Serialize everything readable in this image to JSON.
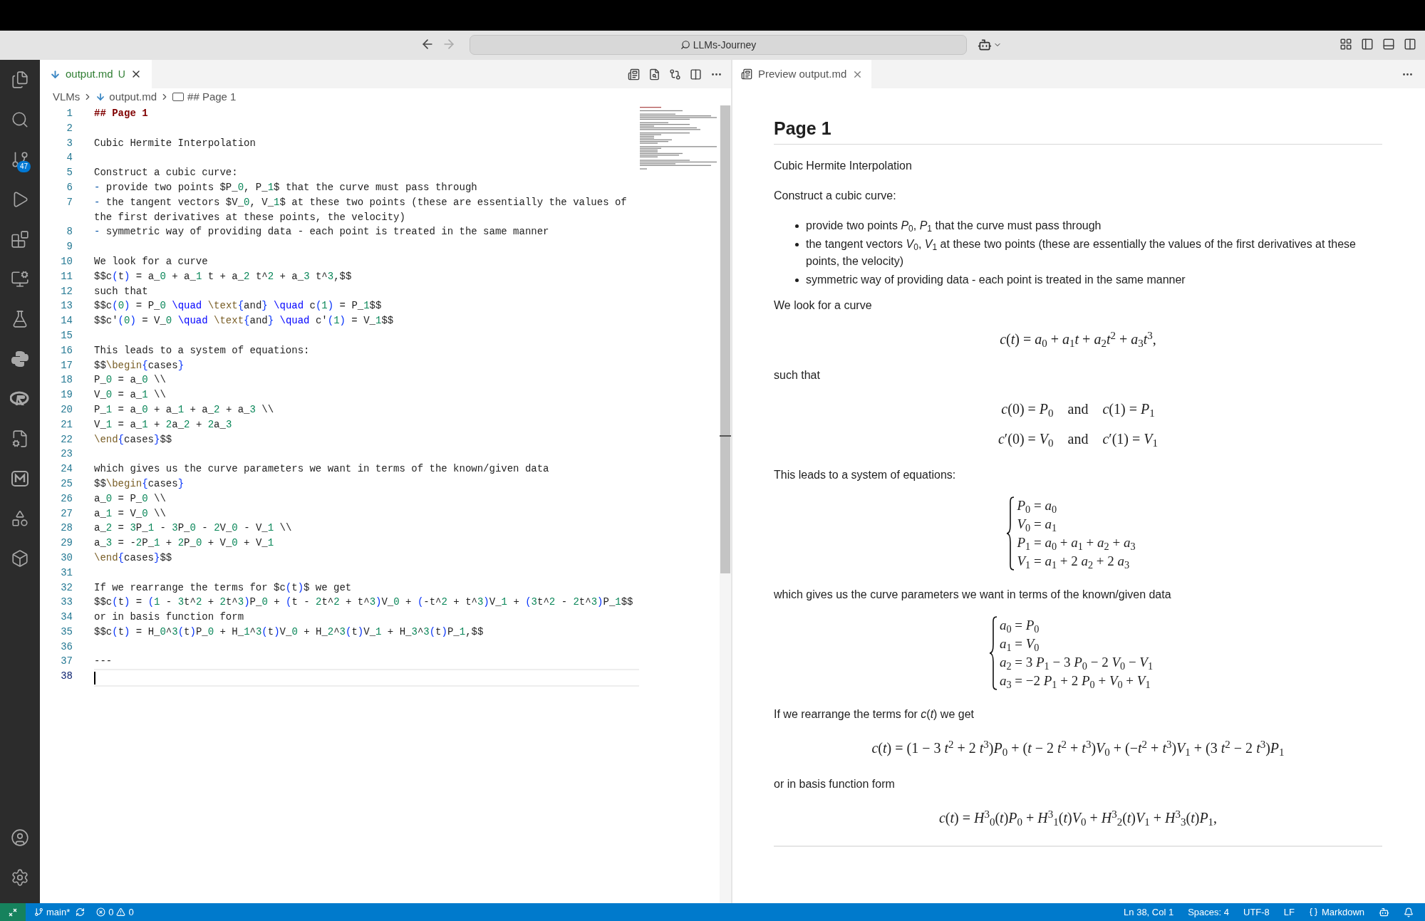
{
  "title_bar": {
    "search": "LLMs-Journey"
  },
  "activity_bar": {
    "source_control_badge": "47"
  },
  "editor": {
    "tab": {
      "label": "output.md",
      "status": "U",
      "selected": true
    },
    "breadcrumb": [
      {
        "text": "VLMs",
        "kind": "folder"
      },
      {
        "text": "output.md",
        "kind": "file"
      },
      {
        "text": "## Page 1",
        "kind": "symbol"
      }
    ],
    "lines": [
      {
        "number": "1",
        "active": false,
        "tokens": [
          {
            "text": "## Page 1",
            "kind": "heading"
          }
        ]
      },
      {
        "number": "2",
        "active": false
      },
      {
        "number": "3",
        "active": false,
        "tokens": [
          {
            "text": "Cubic Hermite Interpolation",
            "kind": "text"
          }
        ]
      },
      {
        "number": "4",
        "active": false
      },
      {
        "number": "5",
        "active": false,
        "tokens": [
          {
            "text": "Construct a cubic curve:",
            "kind": "text"
          }
        ]
      },
      {
        "number": "6",
        "active": false,
        "tokens": [
          {
            "text": "- ",
            "kind": "marker"
          },
          {
            "text": "provide two points $P_",
            "kind": "text"
          },
          {
            "text": "0",
            "kind": "num"
          },
          {
            "text": ", P_",
            "kind": "text"
          },
          {
            "text": "1",
            "kind": "num"
          },
          {
            "text": "$ that the curve must pass through",
            "kind": "text"
          }
        ]
      },
      {
        "number": "7",
        "active": false,
        "tokens": [
          {
            "text": "- ",
            "kind": "marker"
          },
          {
            "text": "the tangent vectors $V_",
            "kind": "text"
          },
          {
            "text": "0",
            "kind": "num"
          },
          {
            "text": ", V_",
            "kind": "text"
          },
          {
            "text": "1",
            "kind": "num"
          },
          {
            "text": "$ at these two points (these are essentially the values of the first derivatives at these points, the velocity)",
            "kind": "text"
          }
        ]
      },
      {
        "number": "8",
        "active": false,
        "tokens": [
          {
            "text": "- ",
            "kind": "marker"
          },
          {
            "text": "symmetric way of providing data - each point is treated in the same manner",
            "kind": "text"
          }
        ]
      },
      {
        "number": "9",
        "active": false
      },
      {
        "number": "10",
        "active": false,
        "tokens": [
          {
            "text": "We look for a curve",
            "kind": "text"
          }
        ]
      },
      {
        "number": "11",
        "active": false,
        "tokens": [
          {
            "text": "$$c",
            "kind": "text"
          },
          {
            "text": "(",
            "kind": "paren"
          },
          {
            "text": "t",
            "kind": "text"
          },
          {
            "text": ")",
            "kind": "paren"
          },
          {
            "text": " = a_",
            "kind": "text"
          },
          {
            "text": "0",
            "kind": "num"
          },
          {
            "text": " + a_",
            "kind": "text"
          },
          {
            "text": "1",
            "kind": "num"
          },
          {
            "text": " t + a_",
            "kind": "text"
          },
          {
            "text": "2",
            "kind": "num"
          },
          {
            "text": " t^",
            "kind": "text"
          },
          {
            "text": "2",
            "kind": "num"
          },
          {
            "text": " + a_",
            "kind": "text"
          },
          {
            "text": "3",
            "kind": "num"
          },
          {
            "text": " t^",
            "kind": "text"
          },
          {
            "text": "3",
            "kind": "num"
          },
          {
            "text": ",$$",
            "kind": "text"
          }
        ]
      },
      {
        "number": "12",
        "active": false,
        "tokens": [
          {
            "text": "such that",
            "kind": "text"
          }
        ]
      },
      {
        "number": "13",
        "active": false,
        "tokens": [
          {
            "text": "$$c",
            "kind": "text"
          },
          {
            "text": "(",
            "kind": "paren"
          },
          {
            "text": "0",
            "kind": "num"
          },
          {
            "text": ")",
            "kind": "paren"
          },
          {
            "text": " = P_",
            "kind": "text"
          },
          {
            "text": "0",
            "kind": "num"
          },
          {
            "text": " \\quad ",
            "kind": "cmd"
          },
          {
            "text": "\\text",
            "kind": "func"
          },
          {
            "text": "{",
            "kind": "paren"
          },
          {
            "text": "and",
            "kind": "text"
          },
          {
            "text": "}",
            "kind": "paren"
          },
          {
            "text": " \\quad",
            "kind": "cmd"
          },
          {
            "text": " c",
            "kind": "text"
          },
          {
            "text": "(",
            "kind": "paren"
          },
          {
            "text": "1",
            "kind": "num"
          },
          {
            "text": ")",
            "kind": "paren"
          },
          {
            "text": " = P_",
            "kind": "text"
          },
          {
            "text": "1",
            "kind": "num"
          },
          {
            "text": "$$",
            "kind": "text"
          }
        ]
      },
      {
        "number": "14",
        "active": false,
        "tokens": [
          {
            "text": "$$c'",
            "kind": "text"
          },
          {
            "text": "(",
            "kind": "paren"
          },
          {
            "text": "0",
            "kind": "num"
          },
          {
            "text": ")",
            "kind": "paren"
          },
          {
            "text": " = V_",
            "kind": "text"
          },
          {
            "text": "0",
            "kind": "num"
          },
          {
            "text": " \\quad ",
            "kind": "cmd"
          },
          {
            "text": "\\text",
            "kind": "func"
          },
          {
            "text": "{",
            "kind": "paren"
          },
          {
            "text": "and",
            "kind": "text"
          },
          {
            "text": "}",
            "kind": "paren"
          },
          {
            "text": " \\quad",
            "kind": "cmd"
          },
          {
            "text": " c'",
            "kind": "text"
          },
          {
            "text": "(",
            "kind": "paren"
          },
          {
            "text": "1",
            "kind": "num"
          },
          {
            "text": ")",
            "kind": "paren"
          },
          {
            "text": " = V_",
            "kind": "text"
          },
          {
            "text": "1",
            "kind": "num"
          },
          {
            "text": "$$",
            "kind": "text"
          }
        ]
      },
      {
        "number": "15",
        "active": false
      },
      {
        "number": "16",
        "active": false,
        "tokens": [
          {
            "text": "This leads to a system of equations:",
            "kind": "text"
          }
        ]
      },
      {
        "number": "17",
        "active": false,
        "tokens": [
          {
            "text": "$$",
            "kind": "text"
          },
          {
            "text": "\\begin",
            "kind": "func"
          },
          {
            "text": "{",
            "kind": "paren"
          },
          {
            "text": "cases",
            "kind": "text"
          },
          {
            "text": "}",
            "kind": "paren"
          }
        ]
      },
      {
        "number": "18",
        "active": false,
        "tokens": [
          {
            "text": "P_",
            "kind": "text"
          },
          {
            "text": "0",
            "kind": "num"
          },
          {
            "text": " = a_",
            "kind": "text"
          },
          {
            "text": "0",
            "kind": "num"
          },
          {
            "text": " \\\\",
            "kind": "text"
          }
        ]
      },
      {
        "number": "19",
        "active": false,
        "tokens": [
          {
            "text": "V_",
            "kind": "text"
          },
          {
            "text": "0",
            "kind": "num"
          },
          {
            "text": " = a_",
            "kind": "text"
          },
          {
            "text": "1",
            "kind": "num"
          },
          {
            "text": " \\\\",
            "kind": "text"
          }
        ]
      },
      {
        "number": "20",
        "active": false,
        "tokens": [
          {
            "text": "P_",
            "kind": "text"
          },
          {
            "text": "1",
            "kind": "num"
          },
          {
            "text": " = a_",
            "kind": "text"
          },
          {
            "text": "0",
            "kind": "num"
          },
          {
            "text": " + a_",
            "kind": "text"
          },
          {
            "text": "1",
            "kind": "num"
          },
          {
            "text": " + a_",
            "kind": "text"
          },
          {
            "text": "2",
            "kind": "num"
          },
          {
            "text": " + a_",
            "kind": "text"
          },
          {
            "text": "3",
            "kind": "num"
          },
          {
            "text": " \\\\",
            "kind": "text"
          }
        ]
      },
      {
        "number": "21",
        "active": false,
        "tokens": [
          {
            "text": "V_",
            "kind": "text"
          },
          {
            "text": "1",
            "kind": "num"
          },
          {
            "text": " = a_",
            "kind": "text"
          },
          {
            "text": "1",
            "kind": "num"
          },
          {
            "text": " + ",
            "kind": "text"
          },
          {
            "text": "2",
            "kind": "num"
          },
          {
            "text": "a_",
            "kind": "text"
          },
          {
            "text": "2",
            "kind": "num"
          },
          {
            "text": " + ",
            "kind": "text"
          },
          {
            "text": "2",
            "kind": "num"
          },
          {
            "text": "a_",
            "kind": "text"
          },
          {
            "text": "3",
            "kind": "num"
          }
        ]
      },
      {
        "number": "22",
        "active": false,
        "tokens": [
          {
            "text": "\\end",
            "kind": "func"
          },
          {
            "text": "{",
            "kind": "paren"
          },
          {
            "text": "cases",
            "kind": "text"
          },
          {
            "text": "}",
            "kind": "paren"
          },
          {
            "text": "$$",
            "kind": "text"
          }
        ]
      },
      {
        "number": "23",
        "active": false
      },
      {
        "number": "24",
        "active": false,
        "tokens": [
          {
            "text": "which gives us the curve parameters we want in terms of the known/given data",
            "kind": "text"
          }
        ]
      },
      {
        "number": "25",
        "active": false,
        "tokens": [
          {
            "text": "$$",
            "kind": "text"
          },
          {
            "text": "\\begin",
            "kind": "func"
          },
          {
            "text": "{",
            "kind": "paren"
          },
          {
            "text": "cases",
            "kind": "text"
          },
          {
            "text": "}",
            "kind": "paren"
          }
        ]
      },
      {
        "number": "26",
        "active": false,
        "tokens": [
          {
            "text": "a_",
            "kind": "text"
          },
          {
            "text": "0",
            "kind": "num"
          },
          {
            "text": " = P_",
            "kind": "text"
          },
          {
            "text": "0",
            "kind": "num"
          },
          {
            "text": " \\\\",
            "kind": "text"
          }
        ]
      },
      {
        "number": "27",
        "active": false,
        "tokens": [
          {
            "text": "a_",
            "kind": "text"
          },
          {
            "text": "1",
            "kind": "num"
          },
          {
            "text": " = V_",
            "kind": "text"
          },
          {
            "text": "0",
            "kind": "num"
          },
          {
            "text": " \\\\",
            "kind": "text"
          }
        ]
      },
      {
        "number": "28",
        "active": false,
        "tokens": [
          {
            "text": "a_",
            "kind": "text"
          },
          {
            "text": "2",
            "kind": "num"
          },
          {
            "text": " = ",
            "kind": "text"
          },
          {
            "text": "3",
            "kind": "num"
          },
          {
            "text": "P_",
            "kind": "text"
          },
          {
            "text": "1",
            "kind": "num"
          },
          {
            "text": " - ",
            "kind": "text"
          },
          {
            "text": "3",
            "kind": "num"
          },
          {
            "text": "P_",
            "kind": "text"
          },
          {
            "text": "0",
            "kind": "num"
          },
          {
            "text": " - ",
            "kind": "text"
          },
          {
            "text": "2",
            "kind": "num"
          },
          {
            "text": "V_",
            "kind": "text"
          },
          {
            "text": "0",
            "kind": "num"
          },
          {
            "text": " - V_",
            "kind": "text"
          },
          {
            "text": "1",
            "kind": "num"
          },
          {
            "text": " \\\\",
            "kind": "text"
          }
        ]
      },
      {
        "number": "29",
        "active": false,
        "tokens": [
          {
            "text": "a_",
            "kind": "text"
          },
          {
            "text": "3",
            "kind": "num"
          },
          {
            "text": " = -",
            "kind": "text"
          },
          {
            "text": "2",
            "kind": "num"
          },
          {
            "text": "P_",
            "kind": "text"
          },
          {
            "text": "1",
            "kind": "num"
          },
          {
            "text": " + ",
            "kind": "text"
          },
          {
            "text": "2",
            "kind": "num"
          },
          {
            "text": "P_",
            "kind": "text"
          },
          {
            "text": "0",
            "kind": "num"
          },
          {
            "text": " + V_",
            "kind": "text"
          },
          {
            "text": "0",
            "kind": "num"
          },
          {
            "text": " + V_",
            "kind": "text"
          },
          {
            "text": "1",
            "kind": "num"
          }
        ]
      },
      {
        "number": "30",
        "active": false,
        "tokens": [
          {
            "text": "\\end",
            "kind": "func"
          },
          {
            "text": "{",
            "kind": "paren"
          },
          {
            "text": "cases",
            "kind": "text"
          },
          {
            "text": "}",
            "kind": "paren"
          },
          {
            "text": "$$",
            "kind": "text"
          }
        ]
      },
      {
        "number": "31",
        "active": false
      },
      {
        "number": "32",
        "active": false,
        "tokens": [
          {
            "text": "If we rearrange the terms for $c",
            "kind": "text"
          },
          {
            "text": "(",
            "kind": "paren"
          },
          {
            "text": "t",
            "kind": "text"
          },
          {
            "text": ")",
            "kind": "paren"
          },
          {
            "text": "$ we get",
            "kind": "text"
          }
        ]
      },
      {
        "number": "33",
        "active": false,
        "tokens": [
          {
            "text": "$$c",
            "kind": "text"
          },
          {
            "text": "(",
            "kind": "paren"
          },
          {
            "text": "t",
            "kind": "text"
          },
          {
            "text": ")",
            "kind": "paren"
          },
          {
            "text": " = ",
            "kind": "text"
          },
          {
            "text": "(",
            "kind": "paren"
          },
          {
            "text": "1",
            "kind": "num"
          },
          {
            "text": " - ",
            "kind": "text"
          },
          {
            "text": "3",
            "kind": "num"
          },
          {
            "text": "t^",
            "kind": "text"
          },
          {
            "text": "2",
            "kind": "num"
          },
          {
            "text": " + ",
            "kind": "text"
          },
          {
            "text": "2",
            "kind": "num"
          },
          {
            "text": "t^",
            "kind": "text"
          },
          {
            "text": "3",
            "kind": "num"
          },
          {
            "text": ")",
            "kind": "paren"
          },
          {
            "text": "P_",
            "kind": "text"
          },
          {
            "text": "0",
            "kind": "num"
          },
          {
            "text": " + ",
            "kind": "text"
          },
          {
            "text": "(",
            "kind": "paren"
          },
          {
            "text": "t - ",
            "kind": "text"
          },
          {
            "text": "2",
            "kind": "num"
          },
          {
            "text": "t^",
            "kind": "text"
          },
          {
            "text": "2",
            "kind": "num"
          },
          {
            "text": " + t^",
            "kind": "text"
          },
          {
            "text": "3",
            "kind": "num"
          },
          {
            "text": ")",
            "kind": "paren"
          },
          {
            "text": "V_",
            "kind": "text"
          },
          {
            "text": "0",
            "kind": "num"
          },
          {
            "text": " + ",
            "kind": "text"
          },
          {
            "text": "(",
            "kind": "paren"
          },
          {
            "text": "-t^",
            "kind": "text"
          },
          {
            "text": "2",
            "kind": "num"
          },
          {
            "text": " + t^",
            "kind": "text"
          },
          {
            "text": "3",
            "kind": "num"
          },
          {
            "text": ")",
            "kind": "paren"
          },
          {
            "text": "V_",
            "kind": "text"
          },
          {
            "text": "1",
            "kind": "num"
          },
          {
            "text": " + ",
            "kind": "text"
          },
          {
            "text": "(",
            "kind": "paren"
          },
          {
            "text": "3",
            "kind": "num"
          },
          {
            "text": "t^",
            "kind": "text"
          },
          {
            "text": "2",
            "kind": "num"
          },
          {
            "text": " - ",
            "kind": "text"
          },
          {
            "text": "2",
            "kind": "num"
          },
          {
            "text": "t^",
            "kind": "text"
          },
          {
            "text": "3",
            "kind": "num"
          },
          {
            "text": ")",
            "kind": "paren"
          },
          {
            "text": "P_",
            "kind": "text"
          },
          {
            "text": "1",
            "kind": "num"
          },
          {
            "text": "$$",
            "kind": "text"
          }
        ]
      },
      {
        "number": "34",
        "active": false,
        "tokens": [
          {
            "text": "or in basis function form",
            "kind": "text"
          }
        ]
      },
      {
        "number": "35",
        "active": false,
        "tokens": [
          {
            "text": "$$c",
            "kind": "text"
          },
          {
            "text": "(",
            "kind": "paren"
          },
          {
            "text": "t",
            "kind": "text"
          },
          {
            "text": ")",
            "kind": "paren"
          },
          {
            "text": " = H_",
            "kind": "text"
          },
          {
            "text": "0",
            "kind": "num"
          },
          {
            "text": "^",
            "kind": "text"
          },
          {
            "text": "3",
            "kind": "num"
          },
          {
            "text": "(",
            "kind": "paren"
          },
          {
            "text": "t",
            "kind": "text"
          },
          {
            "text": ")",
            "kind": "paren"
          },
          {
            "text": "P_",
            "kind": "text"
          },
          {
            "text": "0",
            "kind": "num"
          },
          {
            "text": " + H_",
            "kind": "text"
          },
          {
            "text": "1",
            "kind": "num"
          },
          {
            "text": "^",
            "kind": "text"
          },
          {
            "text": "3",
            "kind": "num"
          },
          {
            "text": "(",
            "kind": "paren"
          },
          {
            "text": "t",
            "kind": "text"
          },
          {
            "text": ")",
            "kind": "paren"
          },
          {
            "text": "V_",
            "kind": "text"
          },
          {
            "text": "0",
            "kind": "num"
          },
          {
            "text": " + H_",
            "kind": "text"
          },
          {
            "text": "2",
            "kind": "num"
          },
          {
            "text": "^",
            "kind": "text"
          },
          {
            "text": "3",
            "kind": "num"
          },
          {
            "text": "(",
            "kind": "paren"
          },
          {
            "text": "t",
            "kind": "text"
          },
          {
            "text": ")",
            "kind": "paren"
          },
          {
            "text": "V_",
            "kind": "text"
          },
          {
            "text": "1",
            "kind": "num"
          },
          {
            "text": " + H_",
            "kind": "text"
          },
          {
            "text": "3",
            "kind": "num"
          },
          {
            "text": "^",
            "kind": "text"
          },
          {
            "text": "3",
            "kind": "num"
          },
          {
            "text": "(",
            "kind": "paren"
          },
          {
            "text": "t",
            "kind": "text"
          },
          {
            "text": ")",
            "kind": "paren"
          },
          {
            "text": "P_",
            "kind": "text"
          },
          {
            "text": "1",
            "kind": "num"
          },
          {
            "text": ",$$",
            "kind": "text"
          }
        ]
      },
      {
        "number": "36",
        "active": false
      },
      {
        "number": "37",
        "active": false,
        "tokens": [
          {
            "text": "---",
            "kind": "text"
          }
        ]
      },
      {
        "number": "38",
        "active": true
      }
    ]
  },
  "preview": {
    "tab": {
      "label": "Preview output.md",
      "selected": true
    },
    "blocks": [
      {
        "kind": "heading",
        "text": "Page 1"
      },
      {
        "kind": "paragraph",
        "text": "Cubic Hermite Interpolation"
      },
      {
        "kind": "paragraph",
        "text": "Construct a cubic curve:"
      },
      {
        "kind": "list",
        "items": [
          "provide two points *P*$_{0}$, *P*$_{1}$ that the curve must pass through",
          "the tangent vectors *V*$_{0}$, *V*$_{1}$ at these two points (these are essentially the values of the first derivatives at these points, the velocity)",
          "symmetric way of providing data - each point is treated in the same manner"
        ]
      },
      {
        "kind": "paragraph",
        "text": "We look for a curve"
      },
      {
        "kind": "math",
        "lines": [
          "*c*(*t*) = *a*$_{0}$ + *a*$_{1}$*t* + *a*$_{2}$*t*$^{2}$ + *a*$_{3}$*t*$^{3}$,"
        ]
      },
      {
        "kind": "paragraph",
        "text": "such that"
      },
      {
        "kind": "math",
        "lines": [
          "*c*(0) = *P*$_{0}$    and    *c*(1) = *P*$_{1}$",
          "*c*′(0) = *V*$_{0}$    and    *c*′(1) = *V*$_{1}$"
        ]
      },
      {
        "kind": "paragraph",
        "text": "This leads to a system of equations:"
      },
      {
        "kind": "cases",
        "lines": [
          "*P*$_{0}$ = *a*$_{0}$",
          "*V*$_{0}$ = *a*$_{1}$",
          "*P*$_{1}$ = *a*$_{0}$ + *a*$_{1}$ + *a*$_{2}$ + *a*$_{3}$",
          "*V*$_{1}$ = *a*$_{1}$ + 2 *a*$_{2}$ + 2 *a*$_{3}$"
        ]
      },
      {
        "kind": "paragraph",
        "text": "which gives us the curve parameters we want in terms of the known/given data"
      },
      {
        "kind": "cases",
        "lines": [
          "*a*$_{0}$ = *P*$_{0}$",
          "*a*$_{1}$ = *V*$_{0}$",
          "*a*$_{2}$ = 3 *P*$_{1}$ − 3 *P*$_{0}$ − 2 *V*$_{0}$ − *V*$_{1}$",
          "*a*$_{3}$ = −2 *P*$_{1}$ + 2 *P*$_{0}$ + *V*$_{0}$ + *V*$_{1}$"
        ]
      },
      {
        "kind": "paragraph",
        "text": "If we rearrange the terms for *c*(*t*) we get"
      },
      {
        "kind": "math",
        "lines": [
          "*c*(*t*) = (1 − 3 *t*$^{2}$ + 2 *t*$^{3}$)*P*$_{0}$ + (*t* − 2 *t*$^{2}$ + *t*$^{3}$)*V*$_{0}$ + (−*t*$^{2}$ + *t*$^{3}$)*V*$_{1}$ + (3 *t*$^{2}$ − 2 *t*$^{3}$)*P*$_{1}$"
        ]
      },
      {
        "kind": "paragraph",
        "text": "or in basis function form"
      },
      {
        "kind": "math",
        "lines": [
          "*c*(*t*) = *H*$^{3}$$_{0}$(*t*)*P*$_{0}$ + *H*$^{3}$$_{1}$(*t*)*V*$_{0}$ + *H*$^{3}$$_{2}$(*t*)*V*$_{1}$ + *H*$^{3}$$_{3}$(*t*)*P*$_{1}$,"
        ]
      },
      {
        "kind": "rule"
      }
    ]
  },
  "status_bar": {
    "branch": "main*",
    "errors": "0",
    "warnings": "0",
    "items": [
      {
        "text": "Ln 38, Col 1",
        "kind": "plain"
      },
      {
        "text": "Spaces: 4",
        "kind": "plain"
      },
      {
        "text": "UTF-8",
        "kind": "plain"
      },
      {
        "text": "LF",
        "kind": "plain"
      },
      {
        "text": "Markdown",
        "kind": "language"
      }
    ]
  }
}
